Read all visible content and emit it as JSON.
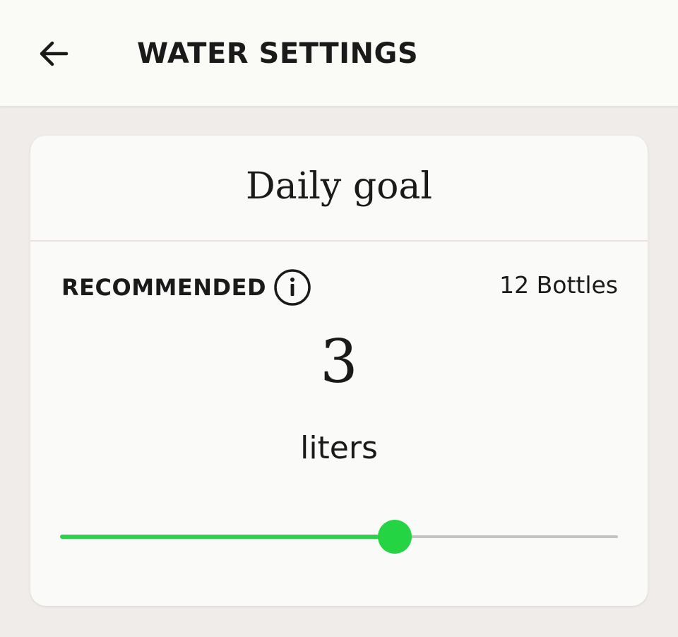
{
  "header": {
    "title": "WATER SETTINGS",
    "back_icon": "arrow-left-icon"
  },
  "card": {
    "title": "Daily goal",
    "recommended_label": "RECOMMENDED",
    "info_icon": "info-icon",
    "bottles_text": "12 Bottles",
    "goal_value": "3",
    "goal_unit": "liters"
  },
  "slider": {
    "fraction": 0.6,
    "fill_color": "#2ed14c",
    "thumb_color": "#25d442",
    "track_color": "#c3c3c1"
  },
  "colors": {
    "background": "#efecea",
    "surface": "#fafaf8",
    "text": "#1a1a1a"
  }
}
